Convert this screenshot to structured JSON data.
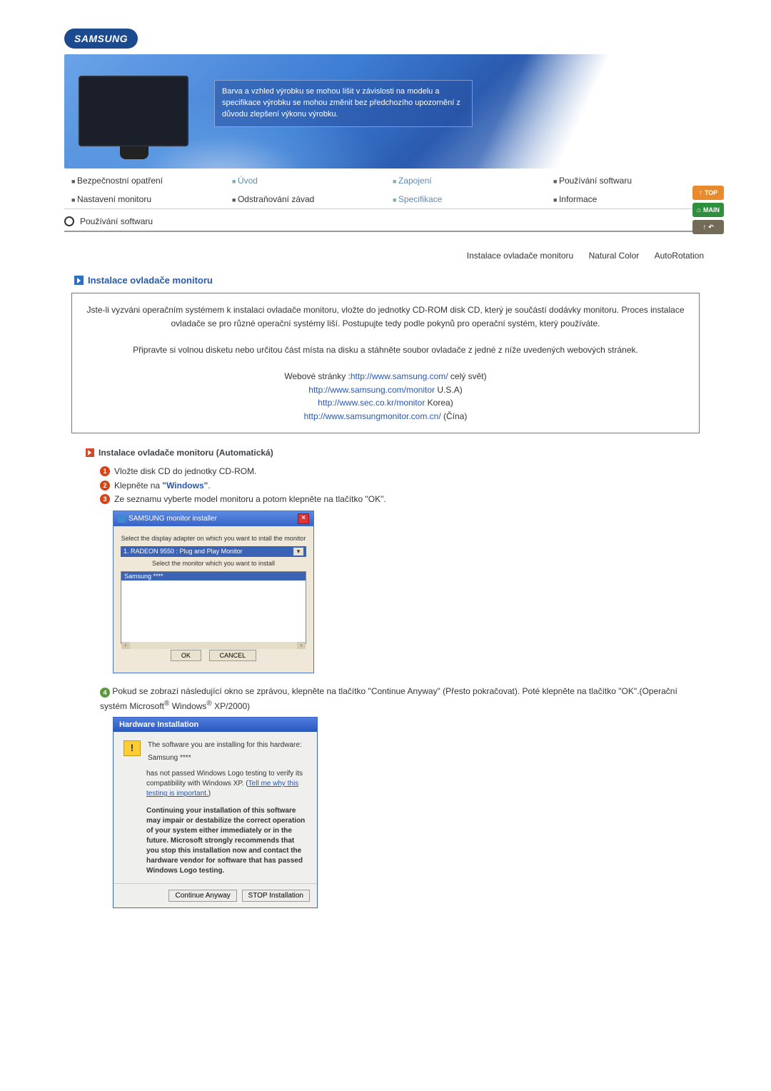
{
  "logo": "SAMSUNG",
  "hero_text": "Barva a vzhled výrobku se mohou lišit v závislosti na modelu a specifikace výrobku se mohou změnit bez předchozího upozornění z důvodu zlepšení výkonu výrobku.",
  "nav_row1": {
    "c1": "Bezpečnostní opatření",
    "c2": "Úvod",
    "c3": "Zapojení",
    "c4": "Používání softwaru"
  },
  "nav_row2": {
    "c1": "Nastavení monitoru",
    "c2": "Odstraňování závad",
    "c3": "Specifikace",
    "c4": "Informace"
  },
  "side": {
    "top": "TOP",
    "main": "MAIN",
    "link": "↶"
  },
  "section_title": "Používání softwaru",
  "sub_tabs": {
    "a": "Instalace ovladače monitoru",
    "b": "Natural Color",
    "c": "AutoRotation"
  },
  "heading_install": "Instalace ovladače monitoru",
  "box": {
    "p1": "Jste-li vyzváni operačním systémem k instalaci ovladače monitoru, vložte do jednotky CD-ROM disk CD, který je součástí dodávky monitoru. Proces instalace ovladače se pro různé operační systémy liší. Postupujte tedy podle pokynů pro operační systém, který používáte.",
    "p2": "Připravte si volnou disketu nebo určitou část místa na disku a stáhněte soubor ovladače z jedné z níže uvedených webových stránek.",
    "web_label": "Webové stránky :",
    "links": {
      "l1": "http://www.samsung.com/",
      "s1": " celý svět)",
      "l2": "http://www.samsung.com/monitor",
      "s2": " U.S.A)",
      "l3": "http://www.sec.co.kr/monitor",
      "s3": " Korea)",
      "l4": "http://www.samsungmonitor.com.cn/",
      "s4": " (Čína)"
    }
  },
  "heading_auto": "Instalace ovladače monitoru (Automatická)",
  "steps": {
    "s1": "Vložte disk CD do jednotky CD-ROM.",
    "s2a": "Klepněte na ",
    "s2b": "\"Windows\"",
    "s2c": ".",
    "s3": "Ze seznamu vyberte model monitoru a potom klepněte na tlačítko \"OK\"."
  },
  "dlg1": {
    "title": "SAMSUNG monitor installer",
    "prompt1": "Select the display adapter on which you want to intall the monitor",
    "select_value": "1. RADEON 9550 : Plug and Play Monitor",
    "prompt2": "Select the monitor which you want to install",
    "list_item": "Samsung ****",
    "ok": "OK",
    "cancel": "CANCEL"
  },
  "step4": {
    "t1": "Pokud se zobrazí následující okno se zprávou, klepněte na tlačítko \"Continue Anyway\" (Přesto pokračovat). Poté klepněte na tlačítko \"OK\".(Operační systém Microsoft",
    "t2": " Windows",
    "t3": " XP/2000)"
  },
  "dlg2": {
    "title": "Hardware Installation",
    "line1": "The software you are installing for this hardware:",
    "line2": "Samsung ****",
    "line3a": "has not passed Windows Logo testing to verify its compatibility with Windows XP. (",
    "line3link": "Tell me why this testing is important.",
    "line3b": ")",
    "bold": "Continuing your installation of this software may impair or destabilize the correct operation of your system either immediately or in the future. Microsoft strongly recommends that you stop this installation now and contact the hardware vendor for software that has passed Windows Logo testing.",
    "btn_continue": "Continue Anyway",
    "btn_stop": "STOP Installation"
  }
}
